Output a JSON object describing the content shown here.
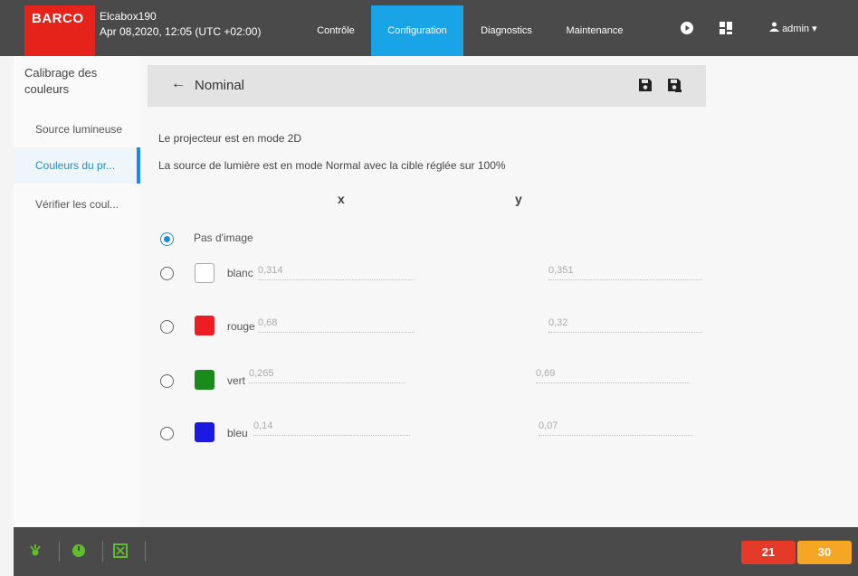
{
  "header": {
    "logo": "BARCO",
    "device_name": "Elcabox190",
    "datetime": "Apr 08,2020, 12:05 (UTC +02:00)",
    "nav_tabs": [
      {
        "label": "Contrôle",
        "active": false
      },
      {
        "label": "Configuration",
        "active": true
      },
      {
        "label": "Diagnostics",
        "active": false
      },
      {
        "label": "Maintenance",
        "active": false
      }
    ],
    "user": "admin"
  },
  "sidebar": {
    "heading": "Calibrage des couleurs",
    "items": [
      {
        "label": "Source lumineuse",
        "active": false
      },
      {
        "label": "Couleurs du pr...",
        "active": true
      },
      {
        "label": "Vérifier les coul...",
        "active": false
      }
    ]
  },
  "main": {
    "title": "Nominal",
    "info_line1": "Le projecteur est en mode 2D",
    "info_line2": "La source de lumière est en mode Normal avec la cible réglée sur 100%",
    "col_x": "x",
    "col_y": "y",
    "no_image_label": "Pas d'image",
    "colors": [
      {
        "label": "blanc",
        "x": "0,314",
        "y": "0,351",
        "swatch": "#ffffff"
      },
      {
        "label": "rouge",
        "x": "0,68",
        "y": "0,32",
        "swatch": "#ee1c25"
      },
      {
        "label": "vert",
        "x": "0,265",
        "y": "0,69",
        "swatch": "#1a8a1a"
      },
      {
        "label": "bleu",
        "x": "0,14",
        "y": "0,07",
        "swatch": "#1a1ae0"
      }
    ]
  },
  "footer": {
    "badge_red": "21",
    "badge_orange": "30"
  },
  "accent_colors": {
    "brand_red": "#e5231b",
    "active_tab": "#1aa4e8",
    "status_green": "#5fbf2a",
    "badge_red": "#e53a2a",
    "badge_orange": "#f5a623"
  }
}
